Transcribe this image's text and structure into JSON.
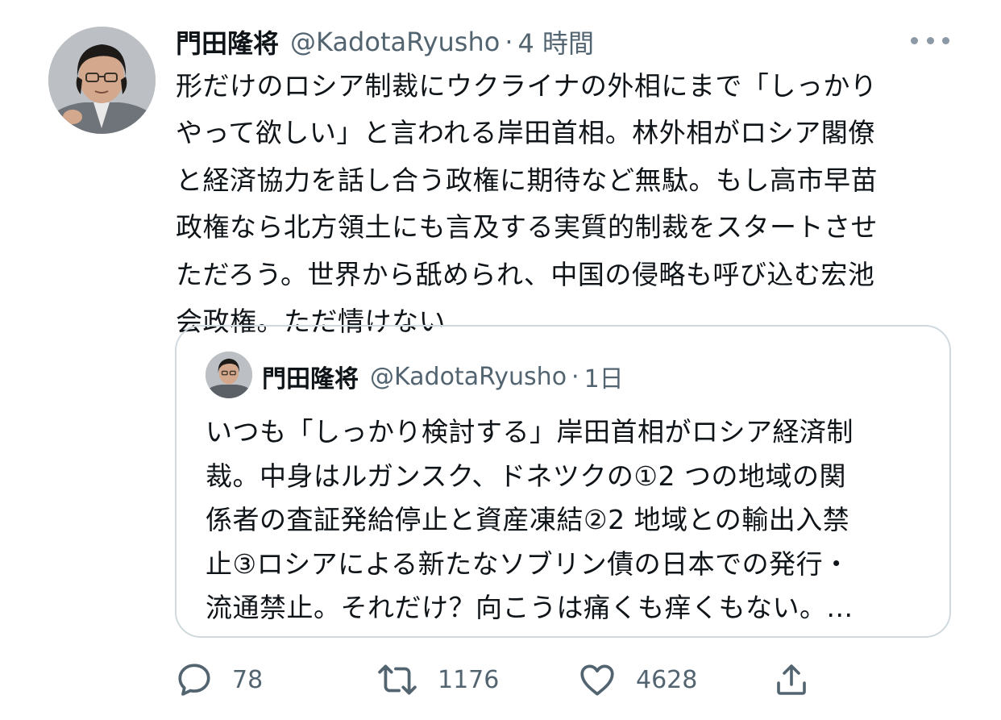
{
  "tweet": {
    "author_name": "門田隆将",
    "handle": "@KadotaRyusho",
    "separator": "·",
    "time": "4 時間",
    "text_lines": [
      "形だけのロシア制裁にウクライナの外相にまで「しっかり",
      "やって欲しい」と言われる岸田首相。林外相がロシア閣僚",
      "と経済協力を話し合う政権に期待など無駄。もし高市早苗",
      "政権なら北方領土にも言及する実質的制裁をスタートさせ",
      "ただろう。世界から舐められ、中国の侵略も呼び込む宏池",
      "会政権。ただ情けない"
    ]
  },
  "quote": {
    "author_name": "門田隆将",
    "handle": "@KadotaRyusho",
    "separator": "·",
    "time": "1日",
    "text_lines": [
      "いつも「しっかり検討する」岸田首相がロシア経済制",
      "裁。中身はルガンスク、ドネツクの①2 つの地域の関",
      "係者の査証発給停止と資産凍結②2 地域との輸出入禁",
      "止③ロシアによる新たなソブリン債の日本での発行・",
      "流通禁止。それだけ？向こうは痛くも痒くもない。..."
    ]
  },
  "actions": {
    "replies": "78",
    "retweets": "1176",
    "likes": "4628"
  },
  "colors": {
    "text": "#0f1419",
    "secondary": "#536471",
    "border": "#cfd9de"
  },
  "icons": [
    "more-icon",
    "reply-icon",
    "retweet-icon",
    "like-icon",
    "share-icon"
  ]
}
